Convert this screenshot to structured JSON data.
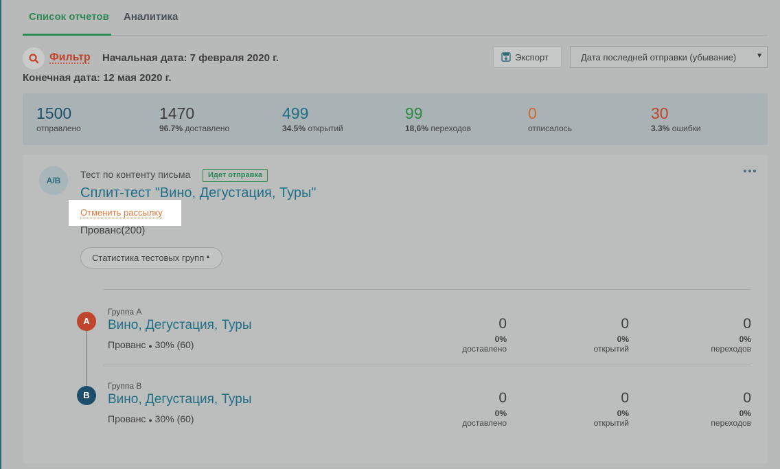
{
  "tabs": [
    {
      "label": "Список отчетов",
      "active": true
    },
    {
      "label": "Аналитика",
      "active": false
    }
  ],
  "filter": {
    "label": "Фильтр",
    "start_date": "Начальная дата: 7 февраля 2020 г.",
    "end_date": "Конечная дата: 12 мая 2020 г."
  },
  "toolbar": {
    "export_label": "Экспорт",
    "sort_selected": "Дата последней отправки (убывание)"
  },
  "stats": [
    {
      "value": "1500",
      "pct": "",
      "label": "отправлено",
      "color": "#1d4f6b"
    },
    {
      "value": "1470",
      "pct": "96.7%",
      "label": "доставлено",
      "color": "#3e3e3e"
    },
    {
      "value": "499",
      "pct": "34.5%",
      "label": "открытий",
      "color": "#1f6f86"
    },
    {
      "value": "99",
      "pct": "18,6%",
      "label": "переходов",
      "color": "#2e8a40"
    },
    {
      "value": "0",
      "pct": "",
      "label": "отписалось",
      "color": "#d0692f"
    },
    {
      "value": "30",
      "pct": "3.3%",
      "label": "ошибки",
      "color": "#c1442d"
    }
  ],
  "campaign": {
    "avatar": "A/B",
    "type": "Тест по контенту письма",
    "status": "Идет отправка",
    "title": "Сплит-тест \"Вино, Дегустация, Туры\"",
    "cancel_label": "Отменить рассылку",
    "audience": "Прованс(200)",
    "stats_toggle": "Статистика тестовых групп"
  },
  "groups": [
    {
      "badge": "A",
      "badge_color": "#c1442d",
      "name": "Группа A",
      "title": "Вино, Дегустация, Туры",
      "audience": "Прованс",
      "share": "30% (60)",
      "metrics": [
        {
          "value": "0",
          "pct": "0%",
          "label": "доставлено"
        },
        {
          "value": "0",
          "pct": "0%",
          "label": "открытий"
        },
        {
          "value": "0",
          "pct": "0%",
          "label": "переходов"
        }
      ]
    },
    {
      "badge": "B",
      "badge_color": "#1d4f6b",
      "name": "Группа B",
      "title": "Вино, Дегустация, Туры",
      "audience": "Прованс",
      "share": "30% (60)",
      "metrics": [
        {
          "value": "0",
          "pct": "0%",
          "label": "доставлено"
        },
        {
          "value": "0",
          "pct": "0%",
          "label": "открытий"
        },
        {
          "value": "0",
          "pct": "0%",
          "label": "переходов"
        }
      ]
    }
  ]
}
